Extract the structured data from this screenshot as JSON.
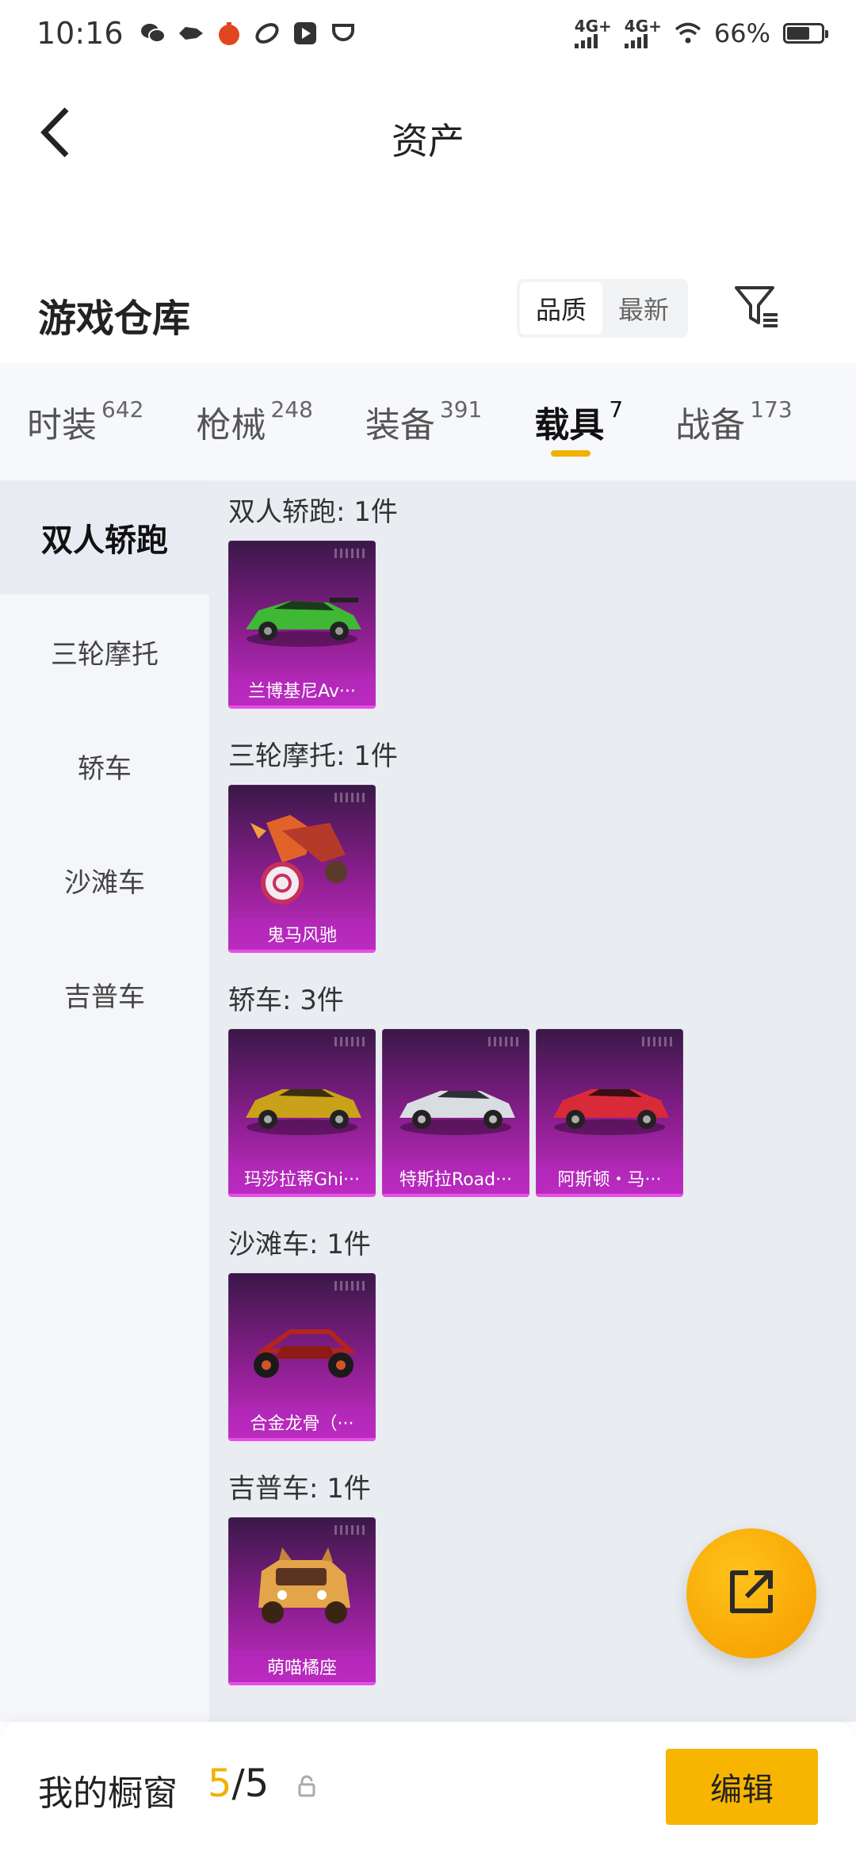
{
  "status_bar": {
    "time": "10:16",
    "net1": "4G+",
    "net2": "4G+",
    "battery_text": "66%",
    "battery_level": 0.66,
    "icons": [
      "wechat-icon",
      "fish-icon",
      "game-icon",
      "link-icon",
      "video-icon",
      "cup-icon"
    ]
  },
  "header": {
    "title": "资产",
    "back_icon": "chevron-left-icon"
  },
  "warehouse": {
    "title": "游戏仓库",
    "sort_options": [
      "品质",
      "最新"
    ],
    "sort_selected": "品质",
    "filter_icon": "filter-icon"
  },
  "tabs": [
    {
      "label": "时装",
      "count": "642",
      "active": false
    },
    {
      "label": "枪械",
      "count": "248",
      "active": false
    },
    {
      "label": "装备",
      "count": "391",
      "active": false
    },
    {
      "label": "载具",
      "count": "7",
      "active": true
    },
    {
      "label": "战备",
      "count": "173",
      "active": false
    }
  ],
  "sidebar": {
    "items": [
      "双人轿跑",
      "三轮摩托",
      "轿车",
      "沙滩车",
      "吉普车"
    ],
    "active_index": 0
  },
  "groups": [
    {
      "title": "双人轿跑: 1件",
      "items": [
        {
          "name": "兰博基尼Av···",
          "art": "green-sports-car"
        }
      ]
    },
    {
      "title": "三轮摩托: 1件",
      "items": [
        {
          "name": "鬼马风驰",
          "art": "ghost-trike"
        }
      ]
    },
    {
      "title": "轿车: 3件",
      "items": [
        {
          "name": "玛莎拉蒂Ghi···",
          "art": "gold-sedan"
        },
        {
          "name": "特斯拉Road···",
          "art": "silver-roadster"
        },
        {
          "name": "阿斯顿・马···",
          "art": "red-coupe"
        }
      ]
    },
    {
      "title": "沙滩车: 1件",
      "items": [
        {
          "name": "合金龙骨（···",
          "art": "buggy"
        }
      ]
    },
    {
      "title": "吉普车: 1件",
      "items": [
        {
          "name": "萌喵橘座",
          "art": "cat-jeep"
        }
      ]
    }
  ],
  "colors": {
    "accent": "#f2b100",
    "card_purple": "#8b1e8f",
    "card_magenta": "#c22ec3"
  },
  "fab": {
    "icon": "share-out-icon"
  },
  "bottom_bar": {
    "label": "我的橱窗",
    "used": "5",
    "slash": "/",
    "total": "5",
    "lock_icon": "lock-icon",
    "edit_label": "编辑"
  }
}
